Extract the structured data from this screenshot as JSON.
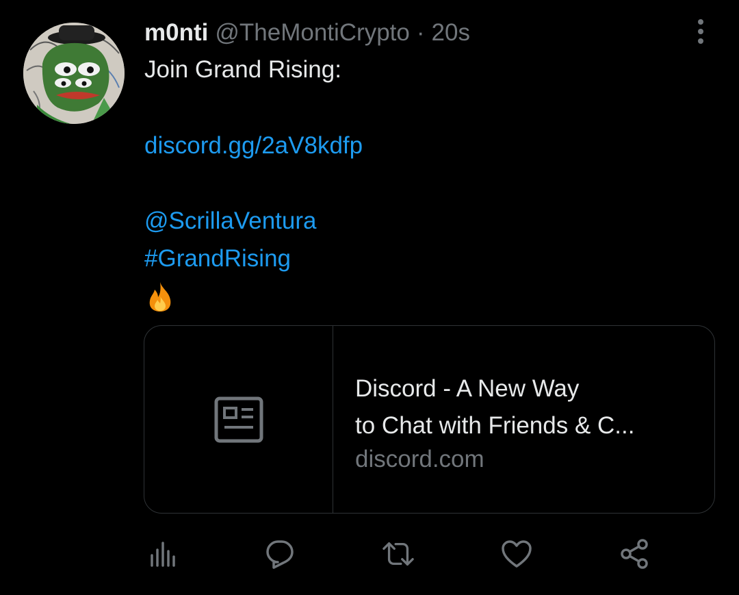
{
  "tweet": {
    "author": {
      "display_name": "m0nti",
      "handle": "@TheMontiCrypto",
      "separator": "·",
      "time": "20s"
    },
    "text": {
      "line1": "Join Grand Rising:",
      "link": "discord.gg/2aV8kdfp",
      "mention": "@ScrillaVentura",
      "hashtag": "#GrandRising",
      "emoji": "🔥"
    },
    "card": {
      "title_line1": "Discord - A New Way",
      "title_line2": "to Chat with Friends & C...",
      "domain": "discord.com",
      "thumbnail_icon": "article-icon"
    },
    "actions": [
      {
        "name": "views",
        "icon": "bar-chart-icon"
      },
      {
        "name": "reply",
        "icon": "reply-icon"
      },
      {
        "name": "retweet",
        "icon": "retweet-icon"
      },
      {
        "name": "like",
        "icon": "heart-icon"
      },
      {
        "name": "share",
        "icon": "share-icon"
      }
    ],
    "colors": {
      "background": "#000000",
      "primary_text": "#e7e9ea",
      "secondary_text": "#71767b",
      "link": "#1d9bf0",
      "border": "#2f3336"
    }
  }
}
